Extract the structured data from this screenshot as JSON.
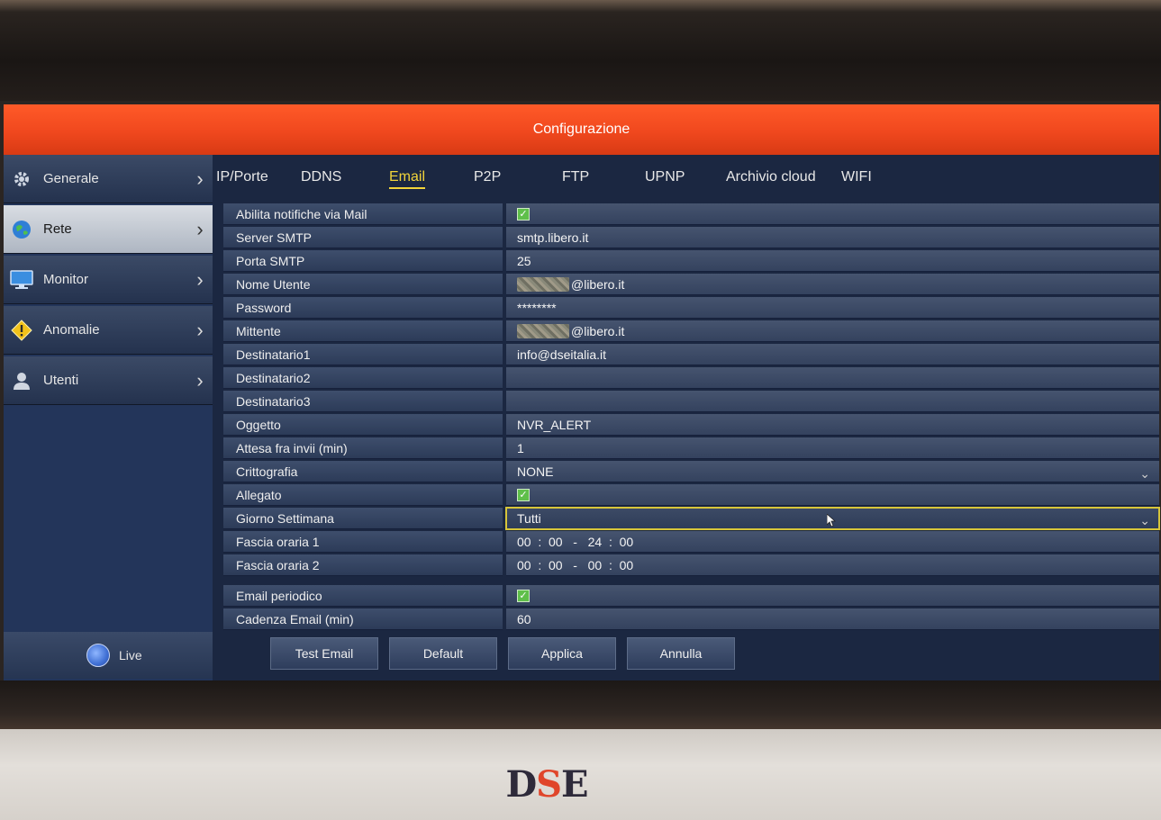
{
  "window": {
    "title": "Configurazione"
  },
  "sidebar": {
    "items": [
      {
        "label": "Generale",
        "icon": "gear-icon",
        "active": false
      },
      {
        "label": "Rete",
        "icon": "globe-icon",
        "active": true
      },
      {
        "label": "Monitor",
        "icon": "monitor-icon",
        "active": false
      },
      {
        "label": "Anomalie",
        "icon": "warning-icon",
        "active": false
      },
      {
        "label": "Utenti",
        "icon": "user-icon",
        "active": false
      }
    ],
    "live_label": "Live"
  },
  "tabs": [
    {
      "label": "IP/Porte",
      "active": false
    },
    {
      "label": "DDNS",
      "active": false
    },
    {
      "label": "Email",
      "active": true
    },
    {
      "label": "P2P",
      "active": false
    },
    {
      "label": "FTP",
      "active": false
    },
    {
      "label": "UPNP",
      "active": false
    },
    {
      "label": "Archivio cloud",
      "active": false
    },
    {
      "label": "WIFI",
      "active": false
    }
  ],
  "form": {
    "enable_mail": {
      "label": "Abilita notifiche via Mail",
      "checked": true
    },
    "smtp_server": {
      "label": "Server SMTP",
      "value": "smtp.libero.it"
    },
    "smtp_port": {
      "label": "Porta SMTP",
      "value": "25"
    },
    "username": {
      "label": "Nome Utente",
      "value": "@libero.it"
    },
    "password": {
      "label": "Password",
      "value": "********"
    },
    "sender": {
      "label": "Mittente",
      "value": "@libero.it"
    },
    "recipient1": {
      "label": "Destinatario1",
      "value": "info@dseitalia.it"
    },
    "recipient2": {
      "label": "Destinatario2",
      "value": ""
    },
    "recipient3": {
      "label": "Destinatario3",
      "value": ""
    },
    "subject": {
      "label": "Oggetto",
      "value": "NVR_ALERT"
    },
    "wait_interval": {
      "label": "Attesa fra invii (min)",
      "value": "1"
    },
    "encryption": {
      "label": "Crittografia",
      "value": "NONE"
    },
    "attachment": {
      "label": "Allegato",
      "checked": true
    },
    "weekday": {
      "label": "Giorno Settimana",
      "value": "Tutti"
    },
    "time_slot1": {
      "label": "Fascia oraria 1",
      "value": "00  :  00   -   24  :  00"
    },
    "time_slot2": {
      "label": "Fascia oraria 2",
      "value": "00  :  00   -   00  :  00"
    },
    "periodic_email": {
      "label": "Email periodico",
      "checked": true
    },
    "email_frequency": {
      "label": "Cadenza Email (min)",
      "value": "60"
    }
  },
  "buttons": {
    "test_email": "Test Email",
    "default": "Default",
    "apply": "Applica",
    "cancel": "Annulla"
  },
  "brand": {
    "logo_text": "DSE"
  },
  "colors": {
    "titlebar": "#f0481e",
    "active_tab": "#f2d43a",
    "checkbox": "#5fbf4a",
    "selection_outline": "#d7c53a"
  }
}
